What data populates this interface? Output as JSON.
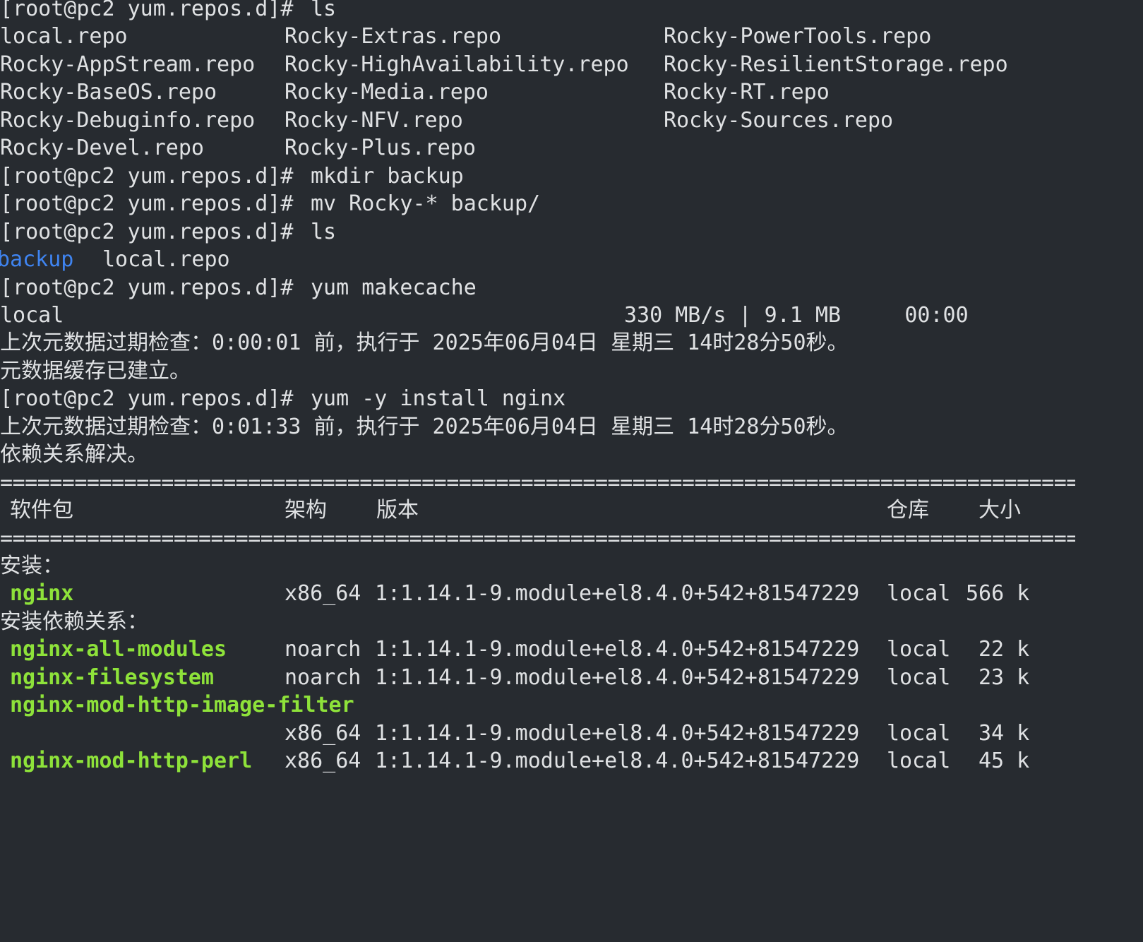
{
  "prompt": "[root@pc2 yum.repos.d]#",
  "colors": {
    "background": "#272b30",
    "foreground": "#dfe1e3",
    "directory": "#3f84f0",
    "package": "#8ee23a"
  },
  "commands": {
    "ls1": "ls",
    "mkdir": "mkdir backup",
    "mv": "mv Rocky-* backup/",
    "ls2": "ls",
    "makecache": "yum makecache",
    "install": "yum -y install nginx"
  },
  "ls1_output": [
    [
      "local.repo",
      "Rocky-Extras.repo",
      "Rocky-PowerTools.repo"
    ],
    [
      "Rocky-AppStream.repo",
      "Rocky-HighAvailability.repo",
      "Rocky-ResilientStorage.repo"
    ],
    [
      "Rocky-BaseOS.repo",
      "Rocky-Media.repo",
      "Rocky-RT.repo"
    ],
    [
      "Rocky-Debuginfo.repo",
      "Rocky-NFV.repo",
      "Rocky-Sources.repo"
    ],
    [
      "Rocky-Devel.repo",
      "Rocky-Plus.repo",
      ""
    ]
  ],
  "ls2_output": {
    "dir": "backup",
    "file": "local.repo"
  },
  "makecache_output": {
    "repo": "local",
    "progress": "330 MB/s | 9.1 MB     00:00",
    "meta_check": "上次元数据过期检查：0:00:01 前，执行于 2025年06月04日 星期三 14时28分50秒。",
    "cache_built": "元数据缓存已建立。"
  },
  "install_output": {
    "meta_check": "上次元数据过期检查：0:01:33 前，执行于 2025年06月04日 星期三 14时28分50秒。",
    "resolved": "依赖关系解决。",
    "rule": "===================================================================================================",
    "headers": {
      "package": "软件包",
      "arch": "架构",
      "version": "版本",
      "repo": "仓库",
      "size": "大小"
    },
    "installing_label": "安装：",
    "deps_label": "安装依赖关系：",
    "packages": [
      {
        "name": "nginx",
        "arch": "x86_64",
        "version": "1:1.14.1-9.module+el8.4.0+542+81547229",
        "repo": "local",
        "size": "566 k"
      },
      {
        "name": "nginx-all-modules",
        "arch": "noarch",
        "version": "1:1.14.1-9.module+el8.4.0+542+81547229",
        "repo": "local",
        "size": "22 k"
      },
      {
        "name": "nginx-filesystem",
        "arch": "noarch",
        "version": "1:1.14.1-9.module+el8.4.0+542+81547229",
        "repo": "local",
        "size": "23 k"
      },
      {
        "name": "nginx-mod-http-image-filter",
        "arch": "x86_64",
        "version": "1:1.14.1-9.module+el8.4.0+542+81547229",
        "repo": "local",
        "size": "34 k"
      },
      {
        "name": "nginx-mod-http-perl",
        "arch": "x86_64",
        "version": "1:1.14.1-9.module+el8.4.0+542+81547229",
        "repo": "local",
        "size": "45 k"
      }
    ]
  }
}
